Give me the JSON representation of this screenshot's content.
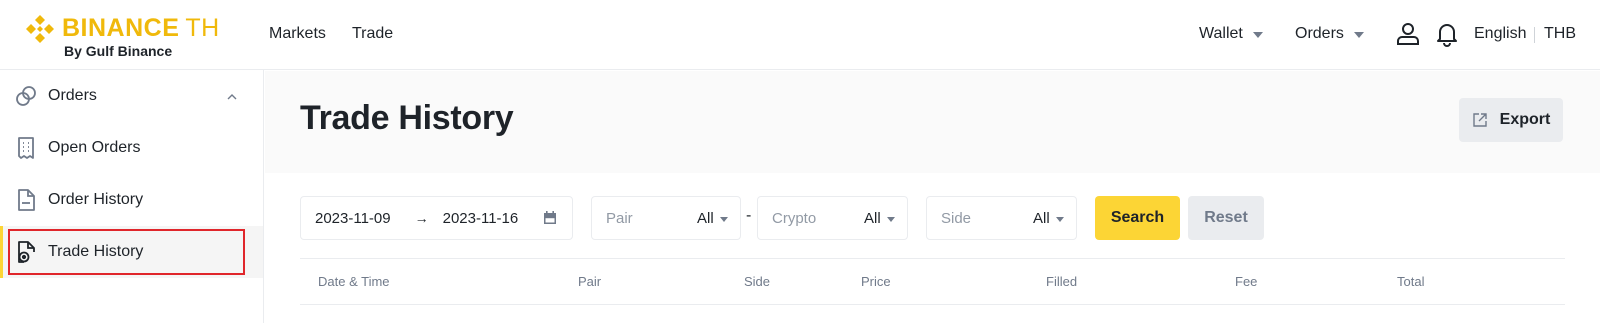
{
  "header": {
    "logo": {
      "brand": "BINANCE",
      "suffix": "TH",
      "tagline": "By Gulf Binance",
      "color": "#F0B90B"
    },
    "nav": [
      {
        "label": "Markets"
      },
      {
        "label": "Trade"
      }
    ],
    "dropdowns": [
      {
        "label": "Wallet"
      },
      {
        "label": "Orders"
      }
    ],
    "icons": [
      "user-icon",
      "bell-icon"
    ],
    "language": "English",
    "currency": "THB"
  },
  "sidebar": {
    "section": {
      "label": "Orders",
      "icon": "orders-link-icon",
      "expanded": true
    },
    "items": [
      {
        "label": "Open Orders",
        "icon": "receipt-icon"
      },
      {
        "label": "Order History",
        "icon": "document-icon"
      },
      {
        "label": "Trade History",
        "icon": "trade-history-icon",
        "active": true
      }
    ]
  },
  "main": {
    "title": "Trade History",
    "export_label": "Export",
    "filters": {
      "date_from": "2023-11-09",
      "date_to": "2023-11-16",
      "date_arrow": "→",
      "pair": {
        "placeholder": "Pair",
        "value": "All"
      },
      "separator": "-",
      "crypto": {
        "placeholder": "Crypto",
        "value": "All"
      },
      "side": {
        "placeholder": "Side",
        "value": "All"
      }
    },
    "search_label": "Search",
    "reset_label": "Reset",
    "table": {
      "columns": [
        "Date & Time",
        "Pair",
        "Side",
        "Price",
        "Filled",
        "Fee",
        "Total"
      ]
    }
  },
  "colors": {
    "accent": "#FCD535",
    "highlight": "#E0262B",
    "text": "#1E2329",
    "muted": "#707A8A"
  }
}
